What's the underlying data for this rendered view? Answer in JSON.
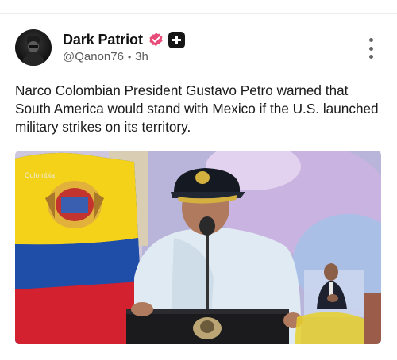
{
  "post": {
    "author_name": "Dark Patriot",
    "handle": "@Qanon76",
    "separator": "•",
    "time": "3h",
    "text": "Narco Colombian President Gustavo Petro warned that South America would stand with Mexico if the U.S. launched military strikes on its territory."
  },
  "icons": {
    "verified": "verified-badge-icon",
    "plus": "plus-badge-icon",
    "more": "more-vertical-icon"
  },
  "media": {
    "watermark": "Colombia"
  },
  "colors": {
    "verified": "#ea4c7a",
    "flag_yellow": "#f4d21a",
    "flag_blue": "#1f4ea8",
    "flag_red": "#d3212f"
  }
}
